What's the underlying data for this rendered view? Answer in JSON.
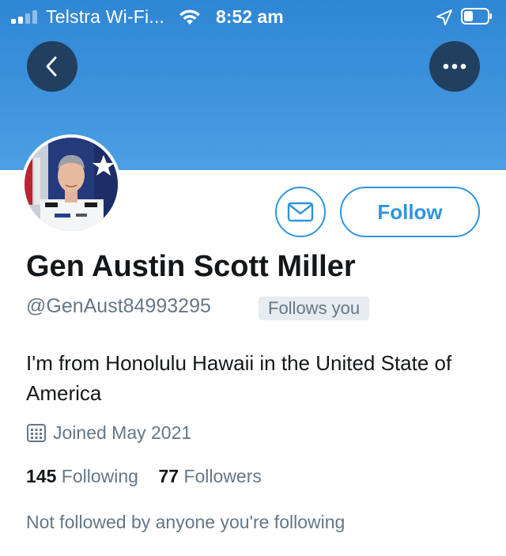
{
  "status_bar": {
    "carrier": "Telstra Wi-Fi...",
    "time": "8:52 am"
  },
  "header": {
    "back_icon": "chevron-left-icon",
    "more_icon": "more-horizontal-icon",
    "banner_color": "#3e93dc"
  },
  "profile": {
    "display_name": "Gen Austin Scott Miller",
    "handle": "@GenAust84993295",
    "follows_you_badge": "Follows you",
    "bio": "I'm from Honolulu Hawaii in the United State of America",
    "joined": "Joined May 2021",
    "following_count": "145",
    "following_label": "Following",
    "followers_count": "77",
    "followers_label": "Followers",
    "mutual_note": "Not followed by anyone you're following"
  },
  "actions": {
    "message_icon": "envelope-icon",
    "follow_label": "Follow",
    "accent_color": "#2f95dc"
  }
}
